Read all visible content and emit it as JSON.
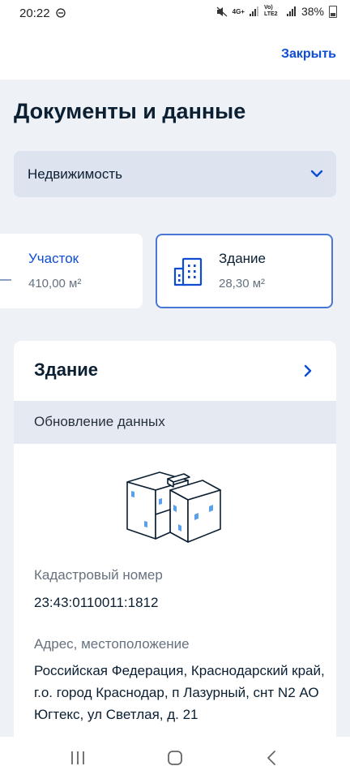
{
  "status_bar": {
    "time": "20:22",
    "network": "4G+",
    "carrier": "Vo) LTE2",
    "battery": "38%"
  },
  "header": {
    "close_label": "Закрыть"
  },
  "page": {
    "title": "Документы и данные",
    "category_dropdown": {
      "selected": "Недвижимость"
    }
  },
  "property_cards": [
    {
      "title": "Участок",
      "area": "410,00 м²",
      "selected": false
    },
    {
      "title": "Здание",
      "area": "28,30 м²",
      "selected": true
    }
  ],
  "detail": {
    "title": "Здание",
    "update_label": "Обновление данных",
    "cadastral_label": "Кадастровый номер",
    "cadastral_number": "23:43:0110011:1812",
    "address_label": "Адрес, местоположение",
    "address": "Российская Федерация, Краснодарский край, г.о. город Краснодар, п Лазурный, снт N2 АО Югтекс, ул Светлая, д. 21"
  },
  "colors": {
    "accent": "#0d4cd3",
    "selected_border": "#4a77d6",
    "background": "#eef1f6",
    "dropdown_bg": "#dde4ef",
    "banner_bg": "#e4e9f2"
  },
  "icons": [
    "dnd-icon",
    "mute-icon",
    "signal-icon",
    "battery-icon",
    "chevron-down-icon",
    "building-icon",
    "chevron-right-icon",
    "recents-icon",
    "home-icon",
    "back-icon"
  ]
}
